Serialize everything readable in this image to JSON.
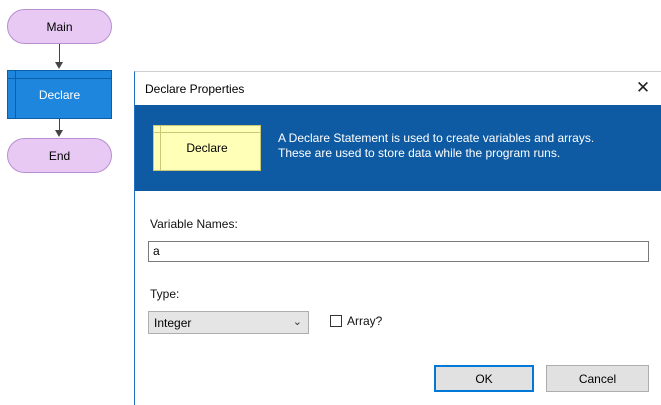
{
  "flowchart": {
    "main_label": "Main",
    "declare_label": "Declare",
    "end_label": "End"
  },
  "dialog": {
    "title": "Declare Properties",
    "close_glyph": "✕",
    "banner": {
      "icon_label": "Declare",
      "line1": "A Declare Statement is used to create variables and arrays.",
      "line2": "These are used to store data while the program runs."
    },
    "variable_names_label": "Variable Names:",
    "variable_names_value": "a",
    "type_label": "Type:",
    "type_value": "Integer",
    "type_chevron": "⌄",
    "array_label": "Array?",
    "array_checked": false,
    "ok_label": "OK",
    "cancel_label": "Cancel"
  },
  "colors": {
    "terminal_fill": "#e8c9f4",
    "process_fill": "#1e86dc",
    "banner_bg": "#0f5ba3",
    "declare_icon_fill": "#ffffb7"
  }
}
